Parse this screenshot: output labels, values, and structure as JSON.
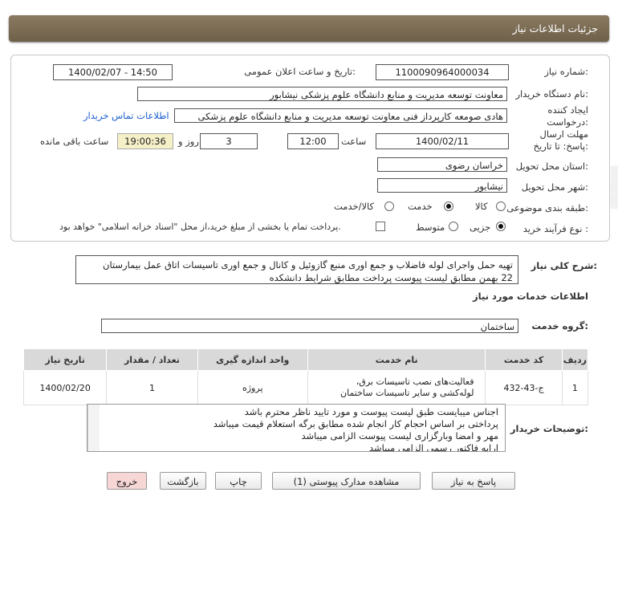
{
  "window_title": "جزئیات اطلاعات نیاز",
  "fields": {
    "need_number_label": "شماره نیاز:",
    "need_number": "1100090964000034",
    "announce_label": "تاریخ و ساعت اعلان عمومی:",
    "announce_value": "1400/02/07 - 14:50",
    "buyer_label": "نام دستگاه خریدار:",
    "buyer_value": "معاونت توسعه مدیریت و منابع دانشگاه علوم پزشکی نیشابور",
    "creator_label": "ایجاد کننده درخواست:",
    "creator_value": "هادی صومعه کارپرداز فنی معاونت توسعه مدیریت و منابع دانشگاه علوم پزشکی",
    "contact_link": "اطلاعات تماس خریدار",
    "deadline_label": "مهلت ارسال پاسخ: تا تاریخ:",
    "deadline_date": "1400/02/11",
    "time_label": "ساعت",
    "deadline_time": "12:00",
    "days_value": "3",
    "days_label": "روز و",
    "remaining_time": "19:00:36",
    "remaining_label": "ساعت باقی مانده",
    "province_label": "استان محل تحویل:",
    "province_value": "خراسان رضوی",
    "city_label": "شهر محل تحویل:",
    "city_value": "نیشابور",
    "category_label": "طبقه بندی موضوعی:",
    "category_options": [
      "کالا",
      "خدمت",
      "کالا/خدمت"
    ],
    "process_label": "نوع فرآیند خرید :",
    "process_options": [
      "جزیی",
      "متوسط"
    ],
    "payment_note": "پرداخت تمام یا بخشی از مبلغ خرید،از محل \"اسناد خزانه اسلامی\" خواهد بود."
  },
  "summary": {
    "label": "شرح کلی نیاز:",
    "line1": "تهیه حمل واجرای لوله فاضلاب و جمع اوری منبع گازوئیل و کانال و جمع اوری تاسیسات اتاق عمل بیمارستان",
    "line2": "22 بهمن مطابق لیست پیوست پرداخت مطابق شرایط دانشکده"
  },
  "services_heading": "اطلاعات خدمات مورد نیاز",
  "service_group_label": "گروه خدمت:",
  "service_group_value": "ساختمان",
  "table": {
    "headers": [
      "ردیف",
      "کد خدمت",
      "نام خدمت",
      "واحد اندازه گیری",
      "تعداد / مقدار",
      "تاریخ نیاز"
    ],
    "rows": [
      [
        "1",
        "ج-43-432",
        "فعالیت‌های نصب تاسیسات برق، لوله‌کشی و سایر تاسیسات ساختمان",
        "پروژه",
        "1",
        "1400/02/20"
      ]
    ]
  },
  "buyer_notes": {
    "label": "توضیحات خریدار:",
    "lines": [
      "اجناس میبایست طبق لیست پیوست و مورد تایید ناظر محترم باشد",
      "پرداختی بر اساس احجام کار انجام شده مطابق برگه استعلام قیمت میباشد",
      "مهر و امضا وبارگزاری لیست پیوست الزامی میباشد",
      "ارایه فاکتور رسمی الزامی میباشد"
    ]
  },
  "buttons": {
    "reply": "پاسخ به نیاز",
    "attachments": "مشاهده مدارک پیوستی (1)",
    "print": "چاپ",
    "back": "بازگشت",
    "exit": "خروج"
  },
  "colors": {
    "titlebar": "#7d6e56",
    "link": "#1a5fd0",
    "remaining_bg": "#f5f0c8",
    "exit_bg": "#f7d6d6"
  }
}
